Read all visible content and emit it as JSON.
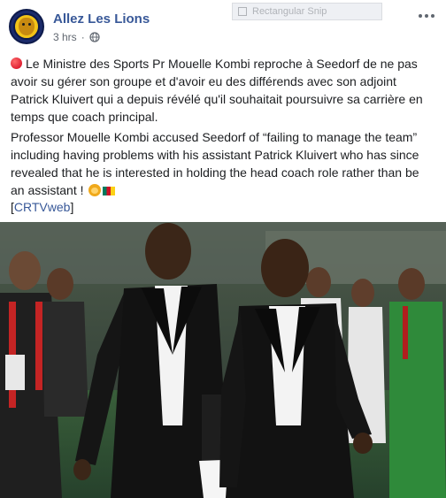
{
  "header": {
    "page_name": "Allez Les Lions",
    "time": "3 hrs",
    "separator": "·",
    "privacy_icon": "globe-icon",
    "avatar_icon": "lion-crest-icon",
    "more_icon": "more-options-icon"
  },
  "overlay": {
    "snip_label": "Rectangular Snip"
  },
  "post": {
    "text_fr": "Le Ministre des Sports Pr Mouelle Kombi reproche à Seedorf de ne pas avoir su gérer son groupe et d'avoir eu des différends avec son adjoint Patrick Kluivert qui a depuis révélé qu'il souhaitait poursuivre sa carrière en temps que coach principal.",
    "text_en": "Professor Mouelle Kombi accused Seedorf of “failing to manage the team” including having problems with his assistant Patrick Kluivert who has since revealed that he is interested in holding the head coach role rather than be an assistant !",
    "link_open": "[",
    "link_text": "CRTVweb",
    "link_close": "]"
  },
  "colors": {
    "link": "#385898",
    "meta": "#606770",
    "text": "#1c1e21"
  }
}
